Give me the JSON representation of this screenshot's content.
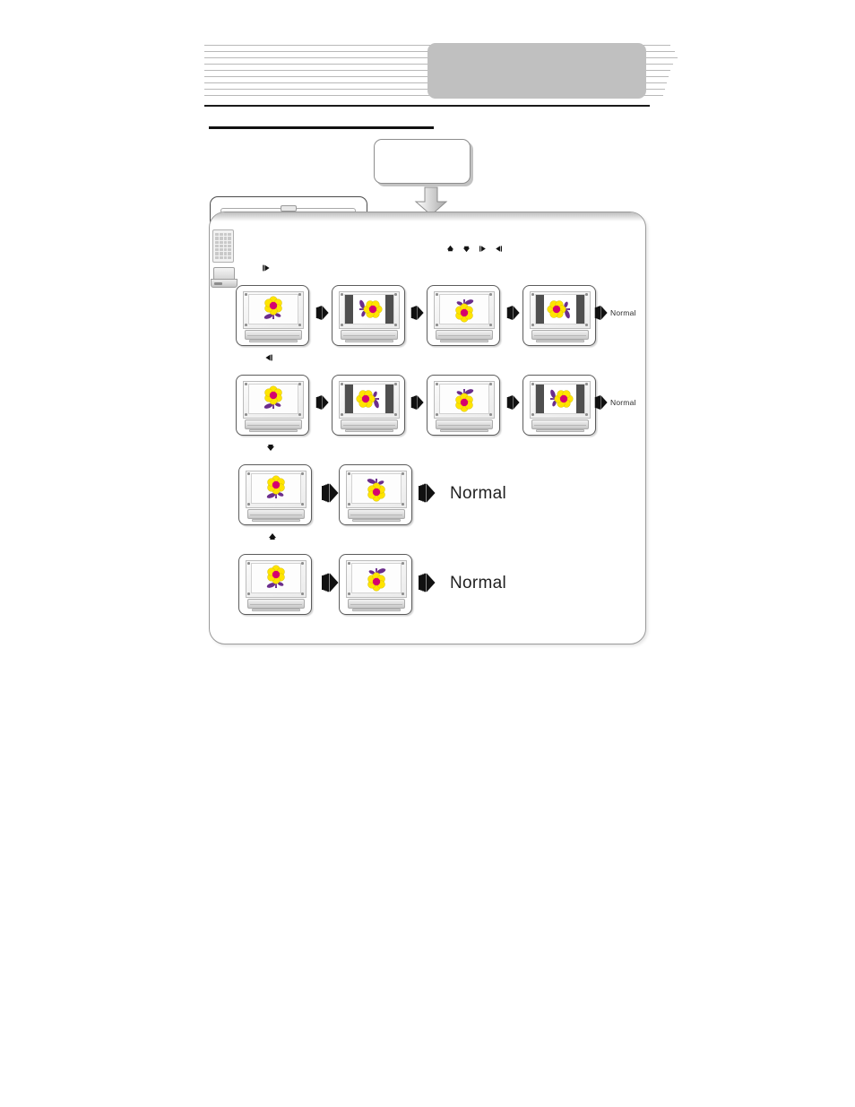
{
  "document": {
    "header": {
      "rule_lines_count": 9,
      "gray_badge_label": "",
      "callout_label": ""
    }
  },
  "legend": {
    "keys": [
      {
        "name": "up-arrow-key",
        "glyph": "▲"
      },
      {
        "name": "down-arrow-key",
        "glyph": "▼"
      },
      {
        "name": "right-arrow-key",
        "glyph": "▶"
      },
      {
        "name": "left-arrow-key",
        "glyph": "◀"
      }
    ]
  },
  "rows": [
    {
      "id": "row-right",
      "marker_glyph": "▶",
      "marker_name": "right-arrow-marker",
      "steps": [
        {
          "rotation": 0,
          "letterbox": false,
          "flip_v": false
        },
        {
          "rotation": 90,
          "letterbox": true,
          "flip_v": false
        },
        {
          "rotation": 180,
          "letterbox": false,
          "flip_v": false
        },
        {
          "rotation": 270,
          "letterbox": true,
          "flip_v": false
        }
      ],
      "end_label": "Normal",
      "end_label_size": "small"
    },
    {
      "id": "row-left",
      "marker_glyph": "◀",
      "marker_name": "left-arrow-marker",
      "steps": [
        {
          "rotation": 0,
          "letterbox": false,
          "flip_v": false
        },
        {
          "rotation": -90,
          "letterbox": true,
          "flip_v": false
        },
        {
          "rotation": -180,
          "letterbox": false,
          "flip_v": false
        },
        {
          "rotation": -270,
          "letterbox": true,
          "flip_v": false
        }
      ],
      "end_label": "Normal",
      "end_label_size": "small"
    },
    {
      "id": "row-down",
      "marker_glyph": "▼",
      "marker_name": "down-arrow-marker",
      "steps": [
        {
          "rotation": 0,
          "letterbox": false,
          "flip_v": false
        },
        {
          "rotation": 0,
          "letterbox": false,
          "flip_v": true
        }
      ],
      "end_label": "Normal",
      "end_label_size": "big"
    },
    {
      "id": "row-up",
      "marker_glyph": "▲",
      "marker_name": "up-arrow-marker",
      "steps": [
        {
          "rotation": 0,
          "letterbox": false,
          "flip_v": false
        },
        {
          "rotation": 180,
          "letterbox": false,
          "flip_v": false
        }
      ],
      "end_label": "Normal",
      "end_label_size": "big"
    }
  ],
  "colors": {
    "flower_petal": "#FFE400",
    "flower_center": "#D6006E",
    "flower_stem": "#6B2D8C",
    "gray_badge": "#C0C0C0",
    "panel_border": "#9A9A9A",
    "letterbox_bar": "#4F4F4F"
  },
  "thumbnails": {
    "remote": "remote-control-thumbnail",
    "device": "projector-device-thumbnail"
  }
}
